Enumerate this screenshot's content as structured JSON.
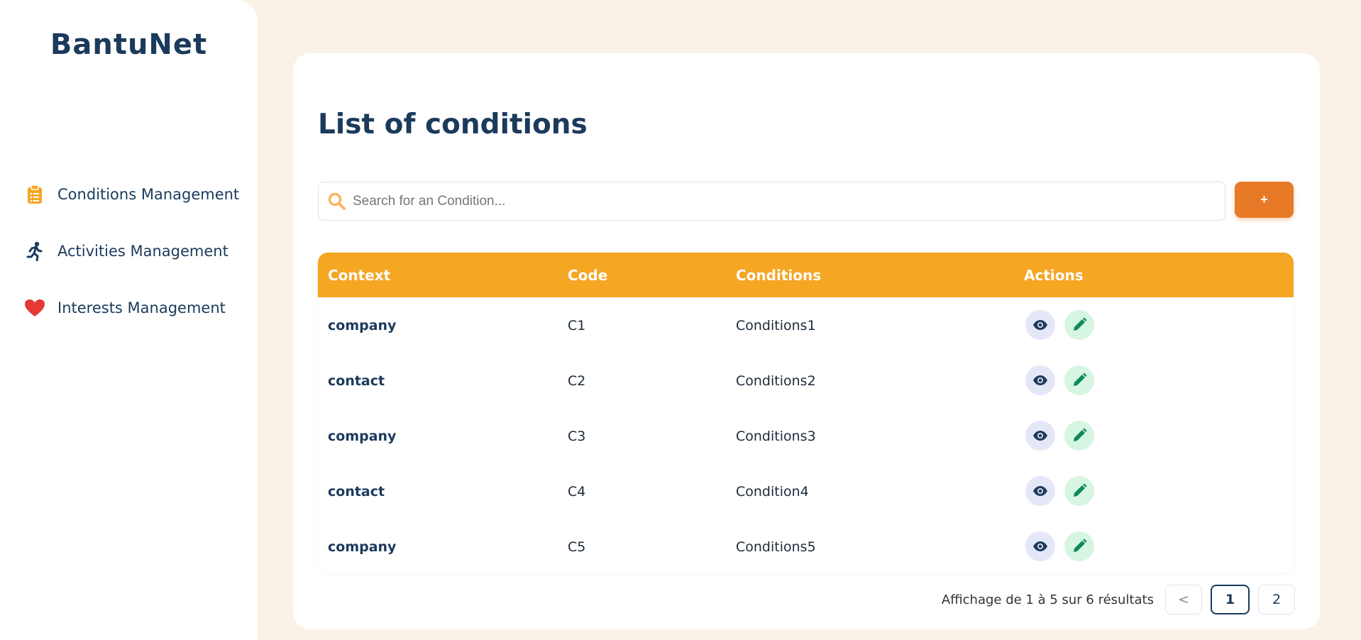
{
  "sidebar": {
    "brand": "BantuNet",
    "items": [
      {
        "label": "Conditions Management",
        "icon": "clipboard-list-icon",
        "color": "#f5a623"
      },
      {
        "label": "Activities Management",
        "icon": "running-person-icon",
        "color": "#1b3a5c"
      },
      {
        "label": "Interests Management",
        "icon": "heart-icon",
        "color": "#e53935"
      }
    ]
  },
  "main": {
    "title": "List of conditions",
    "search": {
      "placeholder": "Search for an Condition...",
      "value": ""
    },
    "add_label": "+",
    "table": {
      "headers": {
        "context": "Context",
        "code": "Code",
        "conditions": "Conditions",
        "actions": "Actions"
      },
      "rows": [
        {
          "context": "company",
          "code": "C1",
          "conditions": "Conditions1"
        },
        {
          "context": "contact",
          "code": "C2",
          "conditions": "Conditions2"
        },
        {
          "context": "company",
          "code": "C3",
          "conditions": "Conditions3"
        },
        {
          "context": "contact",
          "code": "C4",
          "conditions": "Condition4"
        },
        {
          "context": "company",
          "code": "C5",
          "conditions": "Conditions5"
        }
      ]
    },
    "pagination": {
      "info": "Affichage de 1 à 5 sur 6 résultats",
      "prev": "<",
      "pages": [
        "1",
        "2"
      ],
      "current": "1"
    }
  },
  "colors": {
    "background": "#faf1e7",
    "primary": "#1b3a5c",
    "header": "#f5a623",
    "accent": "#e87a27"
  }
}
